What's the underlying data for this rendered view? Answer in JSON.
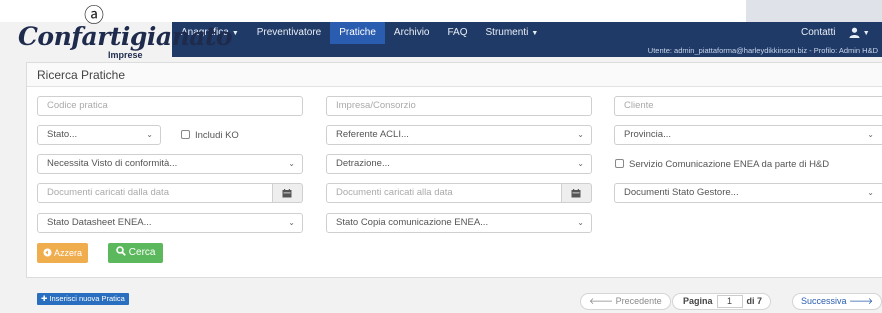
{
  "logo": {
    "at": "ⓐ",
    "brand": "Confartigianato",
    "sub": "Imprese"
  },
  "nav": {
    "items": [
      {
        "label": "Anagrafica",
        "caret": true
      },
      {
        "label": "Preventivatore",
        "caret": false
      },
      {
        "label": "Pratiche",
        "caret": false,
        "active": true
      },
      {
        "label": "Archivio",
        "caret": false
      },
      {
        "label": "FAQ",
        "caret": false
      },
      {
        "label": "Strumenti",
        "caret": true
      }
    ],
    "contatti": "Contatti",
    "user_info": "Utente: admin_piattaforma@harleydikkinson.biz - Profilo: Admin H&D"
  },
  "panel": {
    "title": "Ricerca Pratiche",
    "fields": {
      "codice_pratica": "Codice pratica",
      "impresa_consorzio": "Impresa/Consorzio",
      "cliente": "Cliente",
      "stato": "Stato...",
      "includi_ko": "Includi KO",
      "referente_acli": "Referente ACLI...",
      "provincia": "Provincia...",
      "visto_conformita": "Necessita Visto di conformità...",
      "detrazione": "Detrazione...",
      "servizio_enea": "Servizio Comunicazione ENEA da parte di H&D",
      "doc_dalla_data": "Documenti caricati dalla data",
      "doc_alla_data": "Documenti caricati alla data",
      "doc_stato_gestore": "Documenti Stato Gestore...",
      "stato_datasheet": "Stato Datasheet ENEA...",
      "stato_copia": "Stato Copia comunicazione ENEA..."
    },
    "buttons": {
      "azzera": "Azzera",
      "cerca": "Cerca"
    }
  },
  "footer": {
    "new_button": "Inserisci nuova Pratica",
    "prev": "Precedente",
    "page_label": "Pagina",
    "page_value": "1",
    "page_total": "di 7",
    "next": "Successiva"
  },
  "colors": {
    "navbar": "#1f3a66",
    "active_tab": "#2a5db0",
    "orange": "#f0ad4e",
    "green": "#5cb85c"
  }
}
